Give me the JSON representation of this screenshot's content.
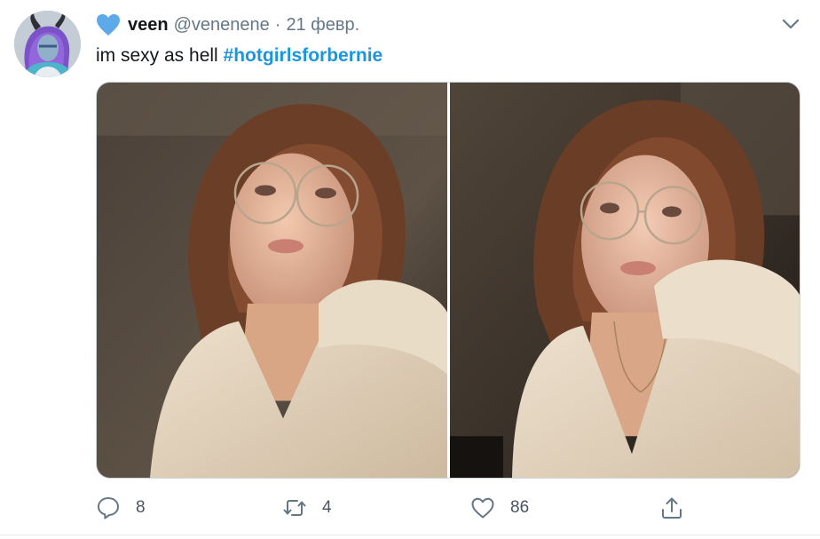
{
  "tweet": {
    "display_name": "veen",
    "handle": "@venenene",
    "separator": "·",
    "date": "21 февр.",
    "text_plain": "im sexy as hell ",
    "hashtag": "#hotgirlsforbernie",
    "badge_icon": "blue-heart-icon",
    "menu_icon": "chevron-down-icon"
  },
  "media": {
    "count": 2,
    "photos": [
      "selfie-photo",
      "selfie-photo"
    ]
  },
  "actions": {
    "reply_count": "8",
    "retweet_count": "4",
    "like_count": "86",
    "reply_icon": "reply-icon",
    "retweet_icon": "retweet-icon",
    "like_icon": "heart-icon",
    "share_icon": "share-icon"
  },
  "colors": {
    "hashtag": "#1b95e0",
    "secondary_text": "#657786",
    "badge_heart": "#5da9e9",
    "border": "#ccd6dd"
  }
}
